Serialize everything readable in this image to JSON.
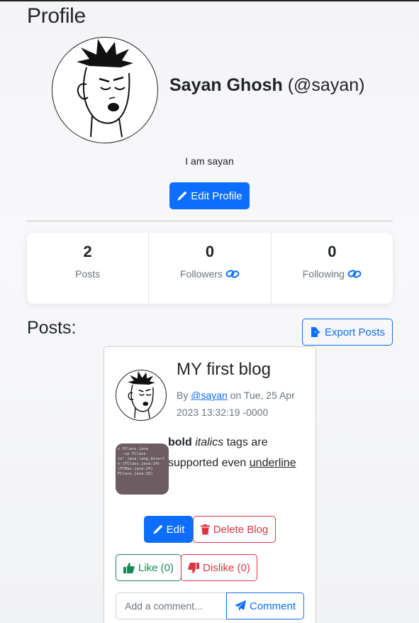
{
  "page": {
    "title": "Profile"
  },
  "profile": {
    "name": "Sayan Ghosh",
    "handle": "(@sayan)",
    "bio": "I am sayan",
    "edit_label": "Edit Profile"
  },
  "stats": [
    {
      "value": "2",
      "label": "Posts",
      "icon": ""
    },
    {
      "value": "0",
      "label": "Followers",
      "icon": "link-icon"
    },
    {
      "value": "0",
      "label": "Following",
      "icon": "link-icon"
    }
  ],
  "posts_section": {
    "heading": "Posts:",
    "export_label": "Export Posts"
  },
  "post": {
    "title": "MY first blog",
    "by": "By",
    "author": "@sayan",
    "on": "on",
    "date": "Tue, 25 Apr 2023 13:32:19 -0000",
    "body_bold": "bold",
    "body_italic": "italics",
    "body_text": "tags are supported even",
    "body_underline": "underline",
    "thumb_text": "c FClass.java\n  -cp FClass\nin\" java.lang.Assert\nn:(FClass.java:14)\n(FCMax.java:24)\nFClass.java:33)",
    "edit_label": "Edit",
    "delete_label": "Delete Blog",
    "like_label": "Like (0)",
    "dislike_label": "Dislike (0)",
    "comment_placeholder": "Add a comment...",
    "comment_label": "Comment"
  },
  "colors": {
    "primary": "#0d6efd",
    "danger": "#dc3545",
    "success": "#198754",
    "muted": "#6c757d"
  }
}
